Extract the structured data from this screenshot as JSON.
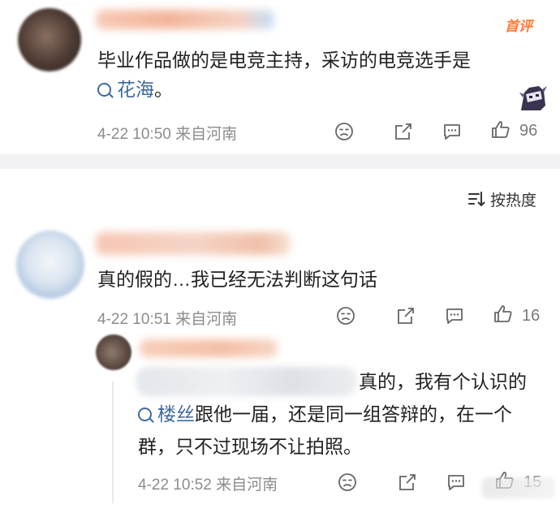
{
  "comment1": {
    "badge": "首评",
    "text_before_link": "毕业作品做的是电竞主持，采访的电竞选手是",
    "link_text": "花海",
    "text_after_link": "。",
    "meta": "4-22 10:50 来自河南",
    "like_count": "96"
  },
  "sort": {
    "label": "按热度"
  },
  "comment2": {
    "text": "真的假的…我已经无法判断这句话",
    "meta": "4-22 10:51 来自河南",
    "like_count": "16"
  },
  "reply1": {
    "text_start": "真的，我有个认识的",
    "link_text": "楼丝",
    "text_rest": "跟他一届，还是同一组答辩的，在一个群，只不过现场不让拍照。",
    "meta": "4-22 10:52 来自河南",
    "like_count": "15"
  },
  "colors": {
    "badge": "#ff7b33",
    "link": "#3f6a9c",
    "meta": "#8c8c8c",
    "divider": "#f2f2f4"
  },
  "icons": [
    "emoji-icon",
    "share-icon",
    "comment-icon",
    "like-icon",
    "sort-icon",
    "search-icon"
  ]
}
